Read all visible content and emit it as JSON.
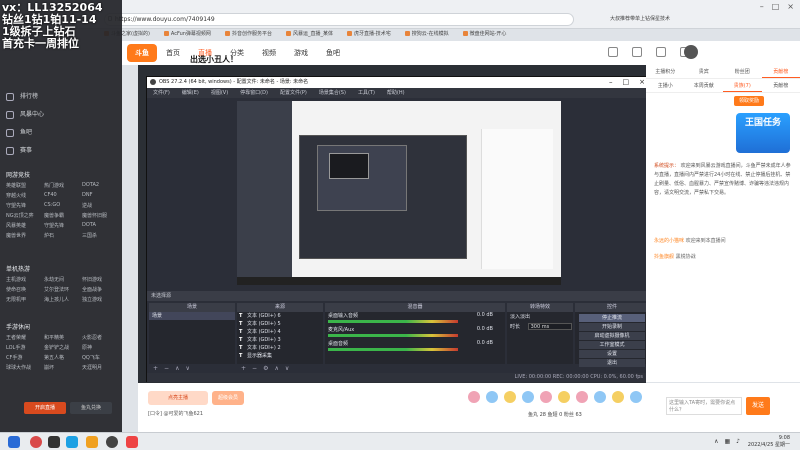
{
  "overlay": {
    "line1": "vx：LL13252064",
    "line2": "钻丝1钻1铂11-14",
    "line3": "1级拆子上钻石",
    "line4": "首充卡一周排位"
  },
  "browser": {
    "url": "https://www.douyu.com/7409149",
    "title": "大叔推荐带单上钻保星技术",
    "bookmarks": [
      "斗鱼之家(虚拟的)",
      "AcFun弹幕视频网",
      "抖音创作服务平台",
      "风暴运_直播_某体",
      "虎牙直播-技术宅",
      "搜狗云-在线模拟",
      "微盘佳网站-开心"
    ]
  },
  "douyu": {
    "logo": "斗鱼",
    "nav": [
      "首页",
      "直播",
      "分类",
      "视频",
      "游戏",
      "鱼吧"
    ],
    "stream_title": "出选小丑人！",
    "sidebar": {
      "items": [
        "排行榜",
        "风暴中心",
        "鱼吧",
        "赛事"
      ],
      "cat1_title": "网游竞技",
      "cat1": [
        "英雄联盟",
        "热门游戏",
        "DOTA2",
        "穿越火线",
        "CF40",
        "DNF",
        "守望先锋",
        "CS:GO",
        "逆战",
        "NG云顶之弈",
        "魔兽争霸",
        "魔兽怀旧服",
        "风暴英雄",
        "守望先锋",
        "DOTA",
        "魔兽世界",
        "炉石",
        "三国杀"
      ],
      "cat2_title": "单机热游",
      "cat2": [
        "主机游戏",
        "永劫无间",
        "怀旧游戏",
        "使命召唤",
        "艾尔登法环",
        "全面战争",
        "无限机甲",
        "海上孩儿人",
        "独立游戏"
      ],
      "cat3_title": "手游休闲",
      "cat3": [
        "王者荣耀",
        "和平精英",
        "火影忍者",
        "LOL手游",
        "金铲铲之战",
        "原神",
        "CF手游",
        "第五人格",
        "QQ飞车",
        "球球大作战",
        "崩坏",
        "天涯明月"
      ],
      "btn_live": "开启直播",
      "btn_app": "鱼丸兑换"
    },
    "right_panel": {
      "tabs": [
        "主播积分",
        "贵宾",
        "粉丝团",
        "贡献榜"
      ],
      "tabs2": [
        "主播小",
        "本周贡献",
        "贵族(7)",
        "贡献榜"
      ],
      "banner": "王国任务",
      "btn_follow": "领取奖励",
      "notice_prefix": "系统提示：",
      "notice": "欢迎来到风暴云游戏直播间，斗鱼严禁未成年人参与直播，直播间内严禁进行24小时在线、禁止停播后挂机、禁止刷量、低俗、血腥暴力、严禁宣传赌博、诈骗等违法违规内容，请文明交流，严禁私下交易。",
      "chat1_name": "永远的小猫咪",
      "chat1_text": "欢迎来到本直播间",
      "chat2_name": "抖鱼旗舰",
      "chat2_text": "黑锐协战",
      "chat_input": "这里输入TA寄时，需要你说点什么？",
      "btn_send": "发送"
    },
    "gift_bar": {
      "btn1": "点亮主播",
      "btn2": "超级会员",
      "msg": "[口令] @可爱的飞鱼621",
      "counts": "鱼丸 28    鱼翅 0    粉丝 63",
      "recharge": "充值"
    }
  },
  "obs": {
    "title": "OBS 27.2.4 (64 bit, windows) - 配置文件: 未命名 - 场景: 未命名",
    "menu": [
      "文件(F)",
      "编辑(E)",
      "视图(V)",
      "停靠窗口(D)",
      "配置文件(P)",
      "场景集合(S)",
      "工具(T)",
      "帮助(H)"
    ],
    "panels_bar": "未选择源",
    "panels": [
      "场景",
      "来源",
      "混音器",
      "转场特效",
      "控件"
    ],
    "scenes": [
      "场景"
    ],
    "sources": [
      "文本 (GDI+) 6",
      "文本 (GDI+) 5",
      "文本 (GDI+) 4",
      "文本 (GDI+) 3",
      "文本 (GDI+) 2",
      "显示器采集"
    ],
    "mixer": [
      {
        "name": "桌面输入音频",
        "db": "0.0 dB"
      },
      {
        "name": "麦克风/Aux",
        "db": "0.0 dB"
      },
      {
        "name": "桌面音频",
        "db": "0.0 dB"
      }
    ],
    "transition": {
      "type": "淡入淡出",
      "label": "时长",
      "duration": "300 ms"
    },
    "controls": [
      "停止推流",
      "开始录制",
      "启动虚拟摄像机",
      "工作室模式",
      "设置",
      "退出"
    ],
    "status": "LIVE: 00:00:00    REC: 00:00:00    CPU: 0.0%, 60.00 fps"
  },
  "taskbar": {
    "time": "9:08",
    "date": "2022/4/25 星期一"
  }
}
